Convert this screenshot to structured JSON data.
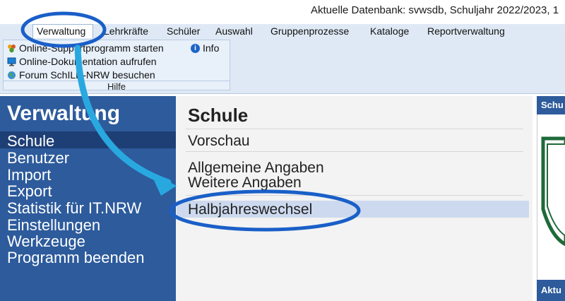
{
  "window": {
    "title": "Aktuelle Datenbank: svwsdb, Schuljahr 2022/2023, 1"
  },
  "menu": {
    "items": [
      "Verwaltung",
      "Lehrkräfte",
      "Schüler",
      "Auswahl",
      "Gruppenprozesse",
      "Kataloge",
      "Reportverwaltung"
    ],
    "active": "Verwaltung"
  },
  "ribbon": {
    "entries": [
      {
        "label": "Online-Supportprogramm starten",
        "icon": "support-icon"
      },
      {
        "label": "Online-Dokumentation aufrufen",
        "icon": "monitor-icon"
      },
      {
        "label": "Forum SchILD-NRW besuchen",
        "icon": "globe-icon"
      }
    ],
    "info": {
      "label": "Info",
      "icon": "info-icon"
    },
    "group_label": "Hilfe"
  },
  "nav": {
    "title": "Verwaltung",
    "items": [
      "Schule",
      "Benutzer",
      "Import",
      "Export",
      "Statistik für IT.NRW",
      "Einstellungen",
      "Werkzeuge",
      "Programm beenden"
    ],
    "selected": "Schule"
  },
  "content": {
    "title": "Schule",
    "links": [
      "Vorschau",
      "Allgemeine Angaben",
      "Weitere Angaben",
      "Halbjahreswechsel"
    ],
    "selected": "Halbjahreswechsel"
  },
  "right_panel": {
    "header": "Schu",
    "footer": "Aktu"
  },
  "colors": {
    "nav_bg": "#2d5b9c",
    "annotation": "#1a5fc8",
    "arrow": "#29a8e0"
  }
}
